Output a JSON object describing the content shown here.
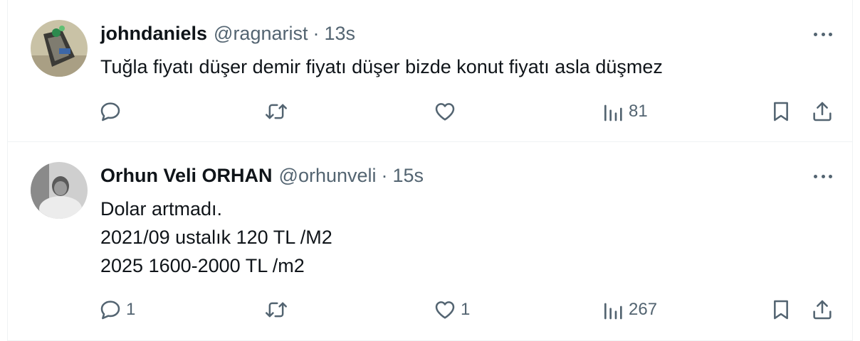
{
  "colors": {
    "text": "#0f1419",
    "muted": "#536471",
    "divider": "#eff3f4"
  },
  "tweets": [
    {
      "name": "johndaniels",
      "handle": "@ragnarist",
      "separator": "·",
      "time": "13s",
      "lines": [
        "Tuğla fiyatı düşer demir fiyatı düşer bizde konut fiyatı asla düşmez"
      ],
      "replies": "",
      "retweets": "",
      "likes": "",
      "views": "81"
    },
    {
      "name": "Orhun Veli ORHAN",
      "handle": "@orhunveli",
      "separator": "·",
      "time": "15s",
      "lines": [
        "Dolar artmadı.",
        "2021/09 ustalık 120 TL /M2",
        "2025 1600-2000 TL /m2"
      ],
      "replies": "1",
      "retweets": "",
      "likes": "1",
      "views": "267"
    }
  ],
  "icons": {
    "more": "more-horizontal-icon",
    "reply": "reply-bubble-icon",
    "retweet": "retweet-icon",
    "like": "heart-icon",
    "views": "views-chart-icon",
    "bookmark": "bookmark-icon",
    "share": "share-upload-icon"
  }
}
